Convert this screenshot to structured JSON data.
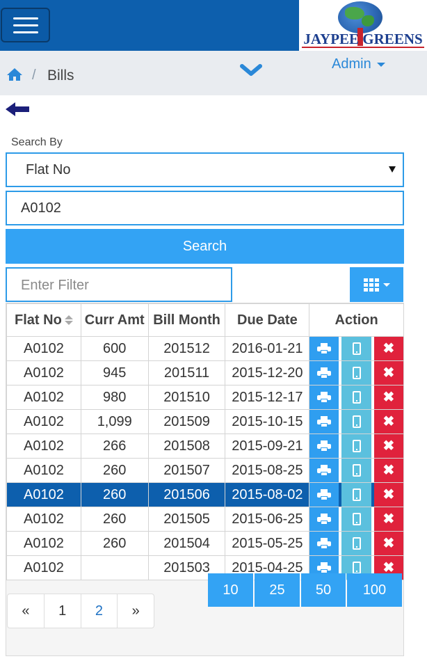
{
  "header": {
    "logo_text": "JAYPEE GREENS",
    "user_menu": "Admin"
  },
  "breadcrumb": {
    "current": "Bills",
    "separator": "/"
  },
  "search": {
    "label": "Search By",
    "selected_field": "Flat No",
    "value": "A0102",
    "button_label": "Search",
    "filter_placeholder": "Enter Filter"
  },
  "table": {
    "headers": [
      "Flat No",
      "Curr Amt",
      "Bill Month",
      "Due Date",
      "Action"
    ],
    "rows": [
      {
        "flat": "A0102",
        "amt": "600",
        "month": "201512",
        "due": "2016-01-21"
      },
      {
        "flat": "A0102",
        "amt": "945",
        "month": "201511",
        "due": "2015-12-20"
      },
      {
        "flat": "A0102",
        "amt": "980",
        "month": "201510",
        "due": "2015-12-17"
      },
      {
        "flat": "A0102",
        "amt": "1,099",
        "month": "201509",
        "due": "2015-10-15"
      },
      {
        "flat": "A0102",
        "amt": "266",
        "month": "201508",
        "due": "2015-09-21"
      },
      {
        "flat": "A0102",
        "amt": "260",
        "month": "201507",
        "due": "2015-08-25"
      },
      {
        "flat": "A0102",
        "amt": "260",
        "month": "201506",
        "due": "2015-08-02",
        "selected": true
      },
      {
        "flat": "A0102",
        "amt": "260",
        "month": "201505",
        "due": "2015-06-25"
      },
      {
        "flat": "A0102",
        "amt": "260",
        "month": "201504",
        "due": "2015-05-25"
      },
      {
        "flat": "A0102",
        "amt": "",
        "month": "201503",
        "due": "2015-04-25"
      }
    ]
  },
  "page_sizes": [
    "10",
    "25",
    "50",
    "100"
  ],
  "pagination": [
    "«",
    "1",
    "2",
    "»"
  ],
  "colors": {
    "header_blue": "#0d5fad",
    "accent_blue": "#33a3f4",
    "delete_red": "#e0223c",
    "mobile_teal": "#5bc0de"
  }
}
